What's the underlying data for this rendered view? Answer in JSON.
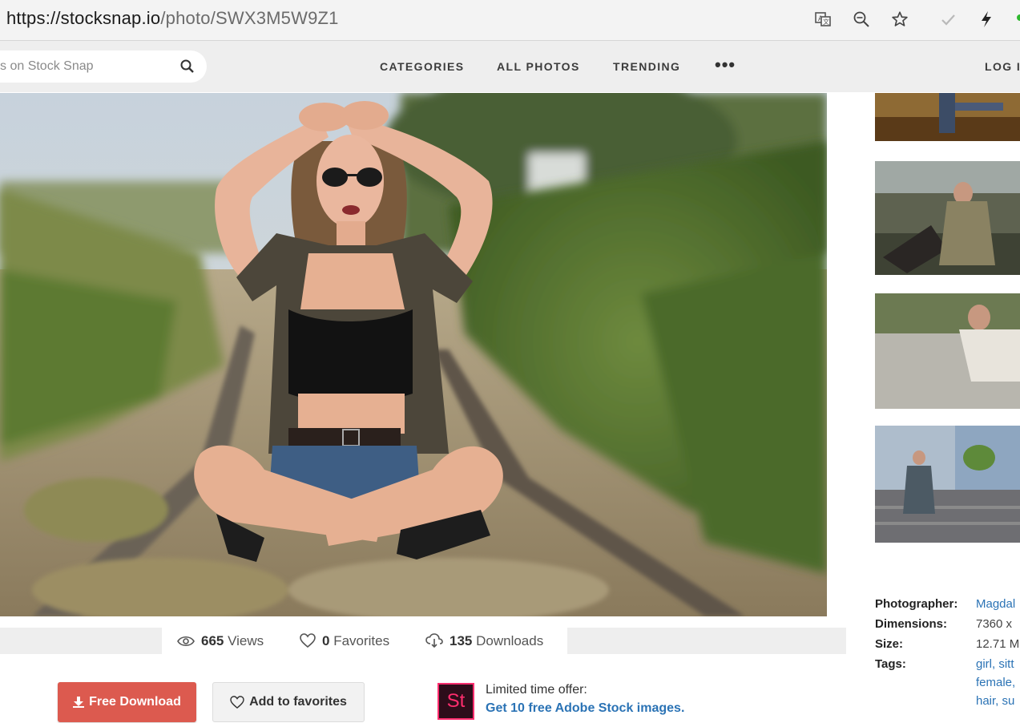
{
  "browser": {
    "url_host": "https://stocksnap.io",
    "url_path": "/photo/SWX3M5W9Z1",
    "icons": [
      "translate-icon",
      "zoom-icon",
      "favorite-star-icon",
      "checkmark-icon",
      "bolt-icon"
    ]
  },
  "nav": {
    "search_placeholder": "s on Stock Snap",
    "items": [
      "CATEGORIES",
      "ALL PHOTOS",
      "TRENDING"
    ],
    "more": "•••",
    "login": "LOG I"
  },
  "stats": {
    "views_count": "665",
    "views_label": "Views",
    "favorites_count": "0",
    "favorites_label": "Favorites",
    "downloads_count": "135",
    "downloads_label": "Downloads"
  },
  "actions": {
    "download_label": "Free Download",
    "favorite_label": "Add to favorites"
  },
  "offer": {
    "logo_text": "St",
    "line1": "Limited time offer:",
    "line2": "Get 10 free Adobe Stock images."
  },
  "details": {
    "photographer_label": "Photographer:",
    "photographer_value": "Magdal",
    "dimensions_label": "Dimensions:",
    "dimensions_value": "7360 x",
    "size_label": "Size:",
    "size_value": "12.71 M",
    "tags_label": "Tags:",
    "tags": [
      "girl, sitt",
      "female,",
      "hair, su"
    ]
  },
  "colors": {
    "download_button": "#dc5a4f",
    "link": "#2b73b5",
    "adobe_pink": "#ff2d6e"
  }
}
